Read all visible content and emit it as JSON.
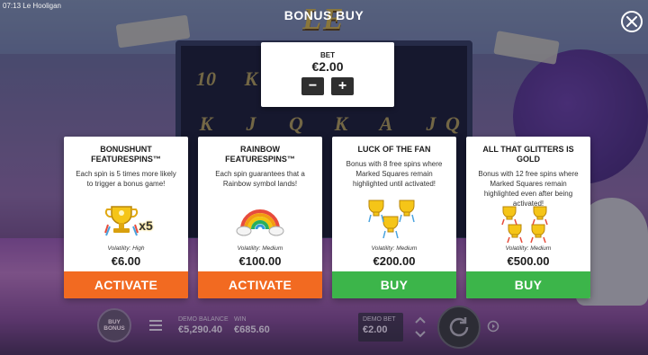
{
  "status": {
    "time": "07:13",
    "app": "Le Hooligan"
  },
  "logo_text": "LE HOOLIGAN",
  "title": "BONUS BUY",
  "reel_symbols": [
    "10",
    "K",
    "K",
    "J",
    "Q",
    "K",
    "A",
    "J",
    "Q"
  ],
  "bet": {
    "label": "BET",
    "value": "€2.00",
    "decrease": "−",
    "increase": "+"
  },
  "cards": [
    {
      "title": "BONUSHUNT FEATURESPINS™",
      "description": "Each spin is 5 times more likely to trigger a bonus game!",
      "multiplier": "x5",
      "volatility": "Volatility: High",
      "price": "€6.00",
      "button": "ACTIVATE",
      "button_color": "#f26a21"
    },
    {
      "title": "RAINBOW FEATURESPINS™",
      "description": "Each spin guarantees that a Rainbow symbol lands!",
      "volatility": "Volatility: Medium",
      "price": "€100.00",
      "button": "ACTIVATE",
      "button_color": "#f26a21"
    },
    {
      "title": "LUCK OF THE FAN",
      "description": "Bonus with 8 free spins where Marked Squares remain highlighted until activated!",
      "volatility": "Volatility: Medium",
      "price": "€200.00",
      "button": "BUY",
      "button_color": "#3cb54a"
    },
    {
      "title": "ALL THAT GLITTERS IS GOLD",
      "description": "Bonus with 12 free spins where Marked Squares remain highlighted even after being activated!",
      "volatility": "Volatility: Medium",
      "price": "€500.00",
      "button": "BUY",
      "button_color": "#3cb54a"
    }
  ],
  "hud": {
    "bonus_buy_label": "BUY BONUS",
    "demo_balance_label": "DEMO BALANCE",
    "demo_balance": "€5,290.40",
    "win_label": "WIN",
    "win": "€685.60",
    "demo_bet_label": "DEMO BET",
    "demo_bet": "€2.00"
  },
  "icons": {
    "close": "close-icon",
    "menu": "menu-icon",
    "spin": "spin-icon",
    "autoplay": "autoplay-icon",
    "bet_arrows": "chevron-up-down-icon"
  }
}
